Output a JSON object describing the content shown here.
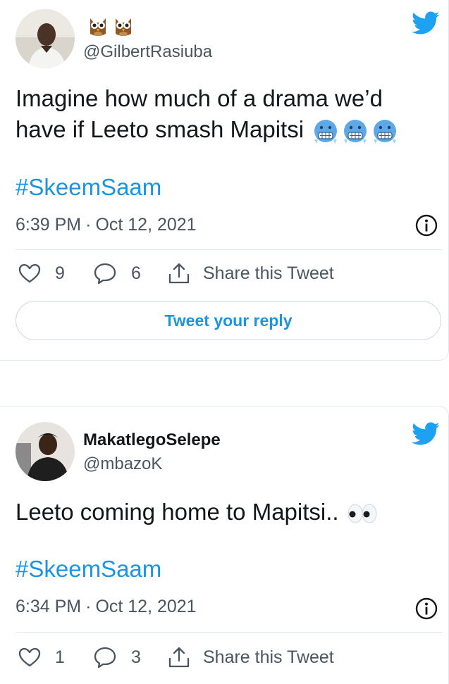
{
  "tweets": [
    {
      "display_name": "",
      "name_emojis": [
        "owl-emoji",
        "owl-emoji"
      ],
      "handle": "@GilbertRasiuba",
      "text": "Imagine how much of a drama we’d have if Leeto smash Mapitsi",
      "text_emojis": [
        "cold-face-emoji",
        "cold-face-emoji",
        "cold-face-emoji"
      ],
      "hashtag": "#SkeemSaam",
      "time": "6:39 PM",
      "separator": "·",
      "date": "Oct 12, 2021",
      "likes": "9",
      "replies": "6",
      "share_label": "Share this Tweet",
      "reply_button_label": "Tweet your reply"
    },
    {
      "display_name": "MakatlegoSelepe",
      "handle": "@mbazoK",
      "text": "Leeto coming home to Mapitsi..",
      "text_emojis": [
        "eyes-emoji"
      ],
      "hashtag": "#SkeemSaam",
      "time": "6:34 PM",
      "separator": "·",
      "date": "Oct 12, 2021",
      "likes": "1",
      "replies": "3",
      "share_label": "Share this Tweet"
    }
  ],
  "colors": {
    "twitter_blue": "#1da1f2",
    "link_blue": "#1b95e0",
    "text_dark": "#14171a",
    "text_gray": "#4a5560",
    "border": "#e1e8ed"
  }
}
